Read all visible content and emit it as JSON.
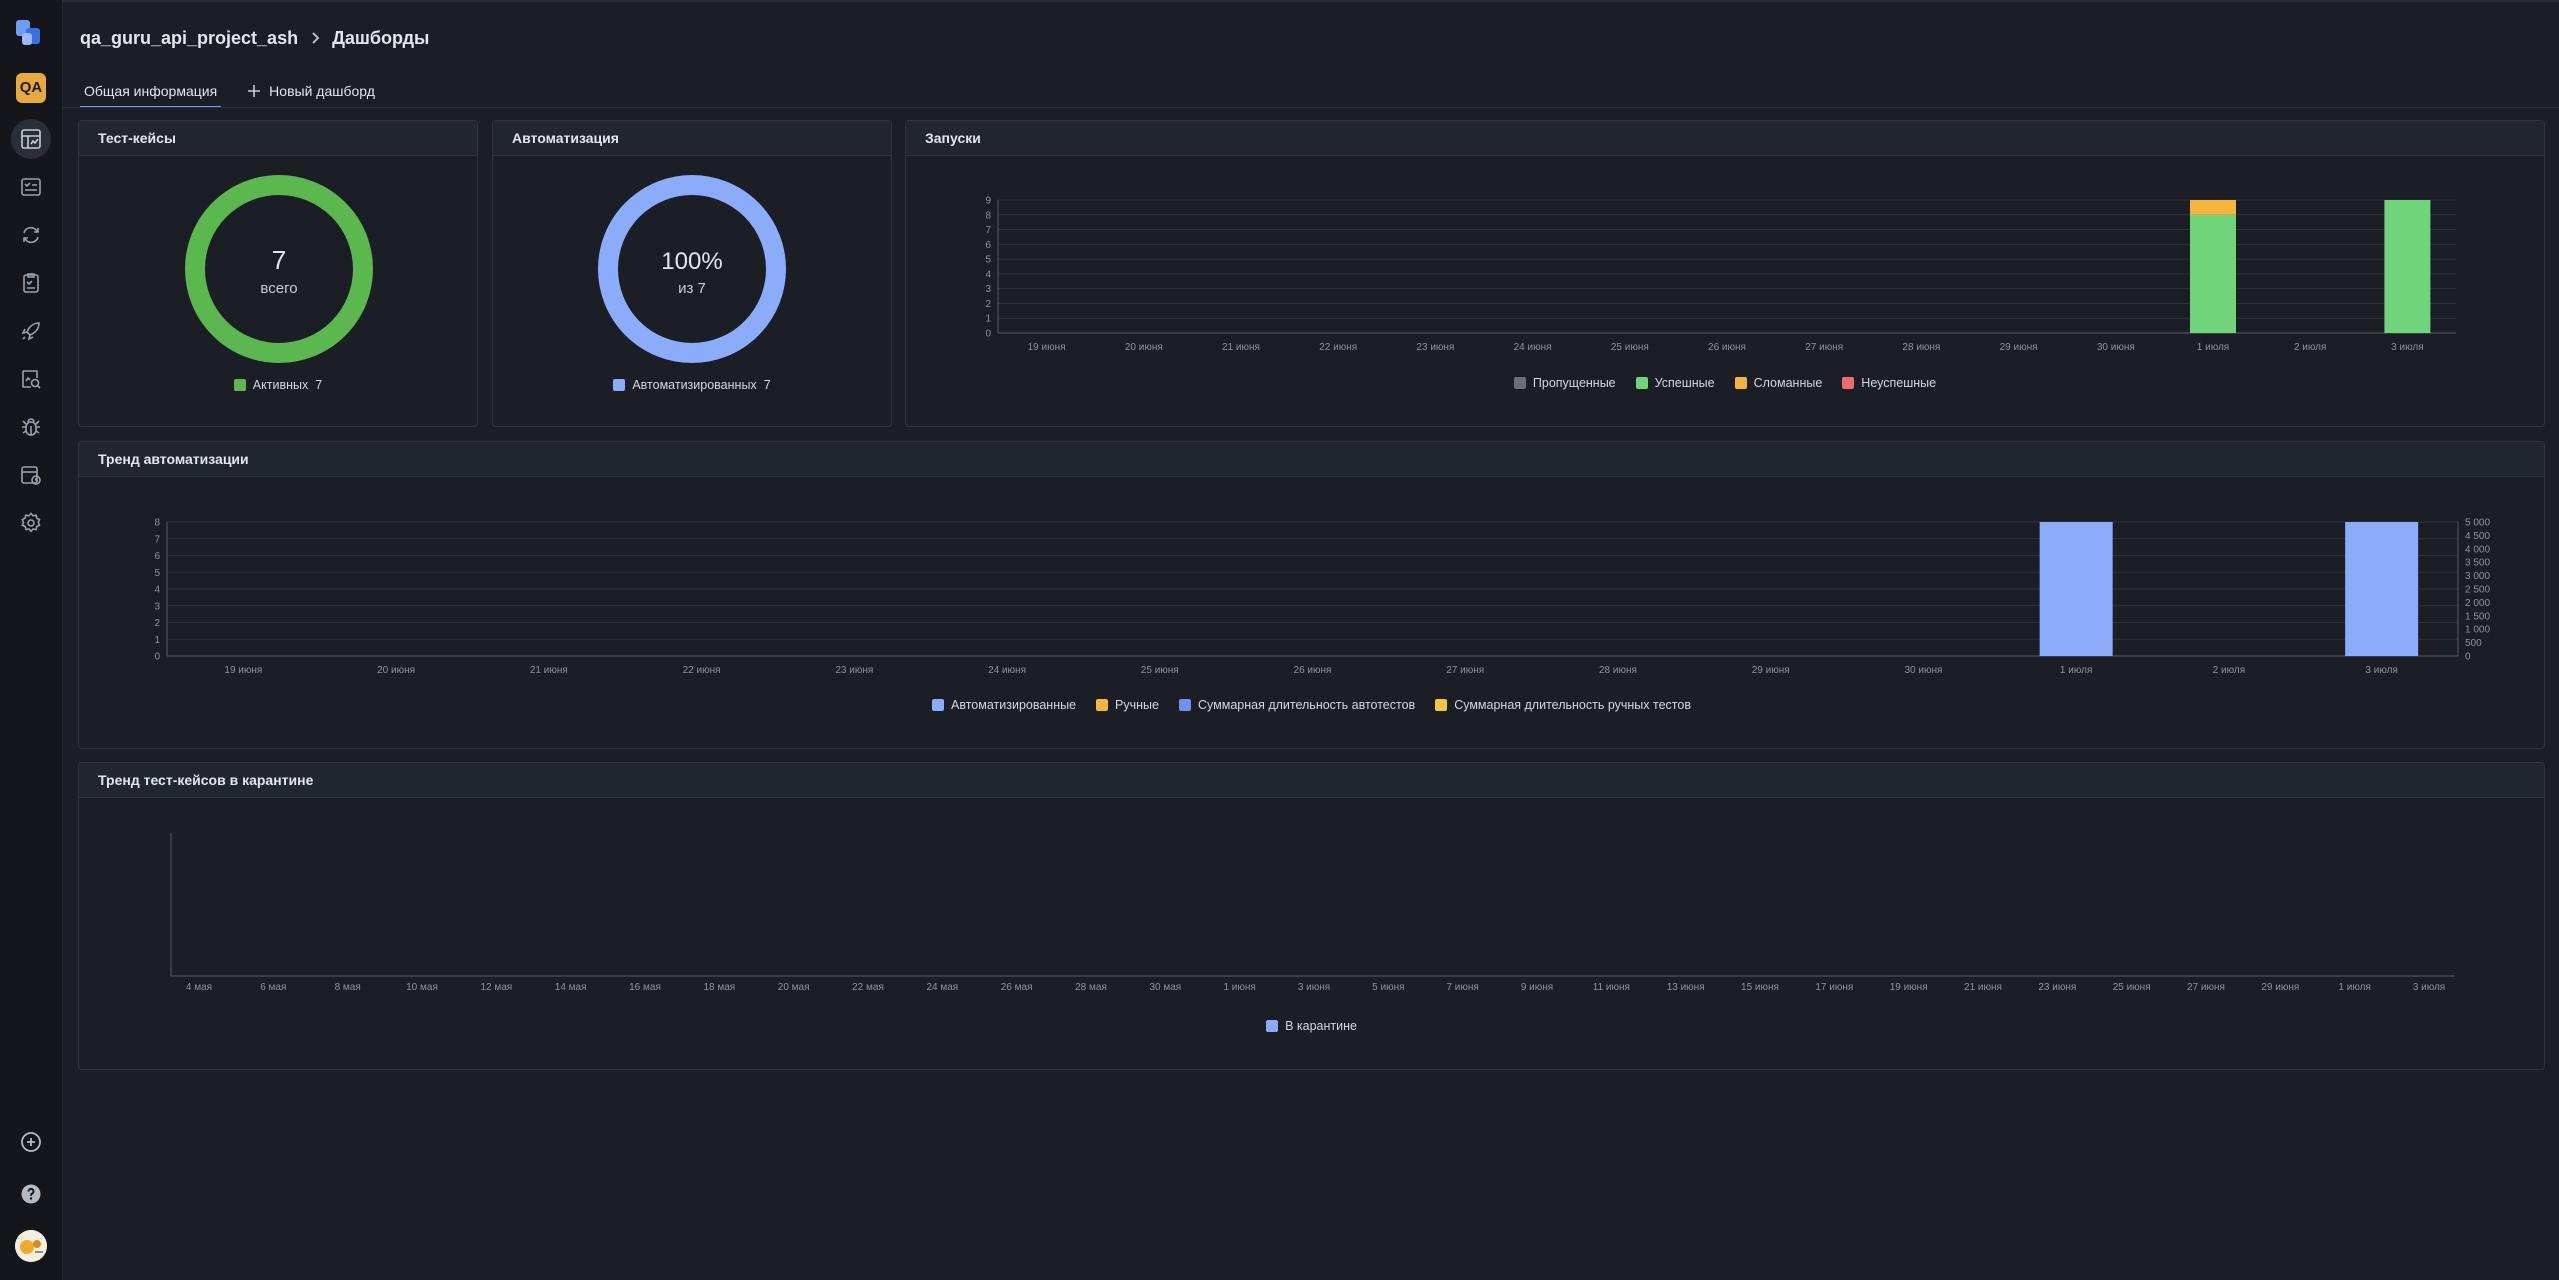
{
  "header": {
    "project": "qa_guru_api_project_ash",
    "page": "Дашборды"
  },
  "sidebar": {
    "project_badge": "QA",
    "items": [
      {
        "icon": "dashboard-icon",
        "active": true
      },
      {
        "icon": "test-cases-icon",
        "active": false
      },
      {
        "icon": "launches-icon",
        "active": false
      },
      {
        "icon": "test-plans-icon",
        "active": false
      },
      {
        "icon": "rocket-icon",
        "active": false
      },
      {
        "icon": "analytics-icon",
        "active": false
      },
      {
        "icon": "bug-icon",
        "active": false
      },
      {
        "icon": "jobs-icon",
        "active": false
      },
      {
        "icon": "gear-icon",
        "active": false
      }
    ],
    "bottom": [
      "add-icon",
      "help-icon",
      "user-avatar"
    ]
  },
  "tabs": [
    {
      "label": "Общая информация",
      "active": true
    },
    {
      "label": "Новый дашборд",
      "active": false,
      "icon": "plus-icon"
    }
  ],
  "widgets": {
    "testcases": {
      "title": "Тест-кейсы",
      "center_value": "7",
      "center_label": "всего",
      "legend_label": "Активных",
      "legend_value": "7",
      "color": "#5bb84f"
    },
    "automation": {
      "title": "Автоматизация",
      "center_value": "100%",
      "center_label": "из 7",
      "legend_label": "Автоматизированных",
      "legend_value": "7",
      "color": "#8aacfa"
    },
    "launches": {
      "title": "Запуски"
    },
    "automation_trend": {
      "title": "Тренд автоматизации"
    },
    "quarantine_trend": {
      "title": "Тренд тест-кейсов в карантине"
    }
  },
  "chart_data": [
    {
      "id": "testcases",
      "type": "pie",
      "series": [
        {
          "name": "Активных",
          "values": [
            7
          ]
        }
      ],
      "colors": [
        "#5bb84f"
      ]
    },
    {
      "id": "automation",
      "type": "pie",
      "series": [
        {
          "name": "Автоматизированных",
          "values": [
            7
          ]
        }
      ],
      "colors": [
        "#8aacfa"
      ]
    },
    {
      "id": "launches",
      "type": "bar",
      "stacked": true,
      "categories": [
        "19 июня",
        "20 июня",
        "21 июня",
        "22 июня",
        "23 июня",
        "24 июня",
        "25 июня",
        "26 июня",
        "27 июня",
        "28 июня",
        "29 июня",
        "30 июня",
        "1 июля",
        "2 июля",
        "3 июля"
      ],
      "ylim": [
        0,
        9
      ],
      "yticks": [
        0,
        1,
        2,
        3,
        4,
        5,
        6,
        7,
        8,
        9
      ],
      "grid": true,
      "legend_position": "bottom",
      "series": [
        {
          "name": "Пропущенные",
          "color": "#6b6f78",
          "values": [
            0,
            0,
            0,
            0,
            0,
            0,
            0,
            0,
            0,
            0,
            0,
            0,
            0,
            0,
            0
          ]
        },
        {
          "name": "Успешные",
          "color": "#6fd47a",
          "values": [
            0,
            0,
            0,
            0,
            0,
            0,
            0,
            0,
            0,
            0,
            0,
            0,
            8,
            0,
            9
          ]
        },
        {
          "name": "Сломанные",
          "color": "#f5b53d",
          "values": [
            0,
            0,
            0,
            0,
            0,
            0,
            0,
            0,
            0,
            0,
            0,
            0,
            1,
            0,
            0
          ]
        },
        {
          "name": "Неуспешные",
          "color": "#f06b6b",
          "values": [
            0,
            0,
            0,
            0,
            0,
            0,
            0,
            0,
            0,
            0,
            0,
            0,
            0,
            0,
            0
          ]
        }
      ]
    },
    {
      "id": "automation_trend",
      "type": "bar",
      "categories": [
        "19 июня",
        "20 июня",
        "21 июня",
        "22 июня",
        "23 июня",
        "24 июня",
        "25 июня",
        "26 июня",
        "27 июня",
        "28 июня",
        "29 июня",
        "30 июня",
        "1 июля",
        "2 июля",
        "3 июля"
      ],
      "ylim": [
        0,
        8
      ],
      "yticks": [
        0,
        1,
        2,
        3,
        4,
        5,
        6,
        7,
        8
      ],
      "y2lim": [
        0,
        5000
      ],
      "y2ticks": [
        "0",
        "500",
        "1 000",
        "1 500",
        "2 000",
        "2 500",
        "3 000",
        "3 500",
        "4 000",
        "4 500",
        "5 000"
      ],
      "grid": true,
      "legend_position": "bottom",
      "series": [
        {
          "name": "Автоматизированные",
          "color": "#8aacfa",
          "values": [
            0,
            0,
            0,
            0,
            0,
            0,
            0,
            0,
            0,
            0,
            0,
            0,
            8,
            0,
            8
          ]
        },
        {
          "name": "Ручные",
          "color": "#f5b53d",
          "values": [
            0,
            0,
            0,
            0,
            0,
            0,
            0,
            0,
            0,
            0,
            0,
            0,
            0,
            0,
            0
          ]
        },
        {
          "name": "Суммарная длительность автотестов",
          "color": "#6f8ff5",
          "values": []
        },
        {
          "name": "Суммарная длительность ручных тестов",
          "color": "#f5c542",
          "values": []
        }
      ]
    },
    {
      "id": "quarantine_trend",
      "type": "line",
      "categories": [
        "4 мая",
        "6 мая",
        "8 мая",
        "10 мая",
        "12 мая",
        "14 мая",
        "16 мая",
        "18 мая",
        "20 мая",
        "22 мая",
        "24 мая",
        "26 мая",
        "28 мая",
        "30 мая",
        "1 июня",
        "3 июня",
        "5 июня",
        "7 июня",
        "9 июня",
        "11 июня",
        "13 июня",
        "15 июня",
        "17 июня",
        "19 июня",
        "21 июня",
        "23 июня",
        "25 июня",
        "27 июня",
        "29 июня",
        "1 июля",
        "3 июля"
      ],
      "grid": false,
      "legend_position": "bottom",
      "series": [
        {
          "name": "В карантине",
          "color": "#8aacfa",
          "values": []
        }
      ]
    }
  ]
}
